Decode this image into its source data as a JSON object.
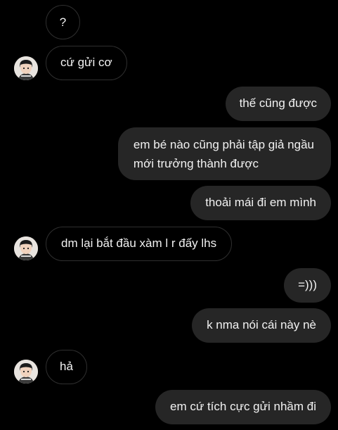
{
  "messages": [
    {
      "sender": "them",
      "text": "?",
      "avatar": false
    },
    {
      "sender": "them",
      "text": "cứ gửi cơ",
      "avatar": true
    },
    {
      "sender": "me",
      "text": "thế cũng được"
    },
    {
      "sender": "me",
      "lines": [
        "em bé nào cũng phải tập giả ngầu",
        "mới trưởng thành được"
      ]
    },
    {
      "sender": "me",
      "text": "thoải mái đi em mình"
    },
    {
      "sender": "them",
      "text": "dm lại bắt đầu xàm l r đấy lhs",
      "avatar": true
    },
    {
      "sender": "me",
      "text": "=)))"
    },
    {
      "sender": "me",
      "text": "k nma nói cái này nè"
    },
    {
      "sender": "them",
      "text": "hả",
      "avatar": true
    },
    {
      "sender": "me",
      "text": "em cứ tích cực gửi nhầm đi"
    }
  ],
  "colors": {
    "background": "#000000",
    "incoming_border": "#2f2f2f",
    "outgoing_fill": "#262626",
    "text": "#f2f2f2"
  },
  "icons": {
    "avatar": "contact-avatar-photo"
  }
}
